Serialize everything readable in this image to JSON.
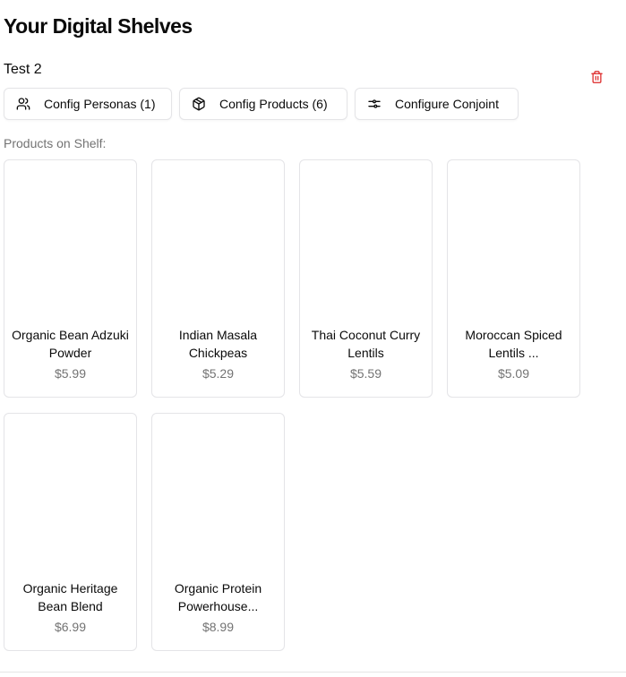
{
  "page": {
    "title": "Your Digital Shelves"
  },
  "shelf": {
    "name": "Test 2",
    "delete_icon": "trash-icon",
    "delete_icon_color": "#dc2626",
    "buttons": [
      {
        "label": "Config Personas (1)",
        "icon": "users-icon"
      },
      {
        "label": "Config Products (6)",
        "icon": "package-icon"
      },
      {
        "label": "Configure Conjoint",
        "icon": "sliders-icon"
      }
    ],
    "products_label": "Products on Shelf:",
    "products": [
      {
        "name": "Organic Bean Adzuki Powder",
        "price": "$5.99"
      },
      {
        "name": "Indian Masala Chickpeas",
        "price": "$5.29"
      },
      {
        "name": "Thai Coconut Curry Lentils",
        "price": "$5.59"
      },
      {
        "name": "Moroccan Spiced Lentils ...",
        "price": "$5.09"
      },
      {
        "name": "Organic Heritage Bean Blend",
        "price": "$6.99"
      },
      {
        "name": "Organic Protein Powerhouse...",
        "price": "$8.99"
      }
    ]
  }
}
